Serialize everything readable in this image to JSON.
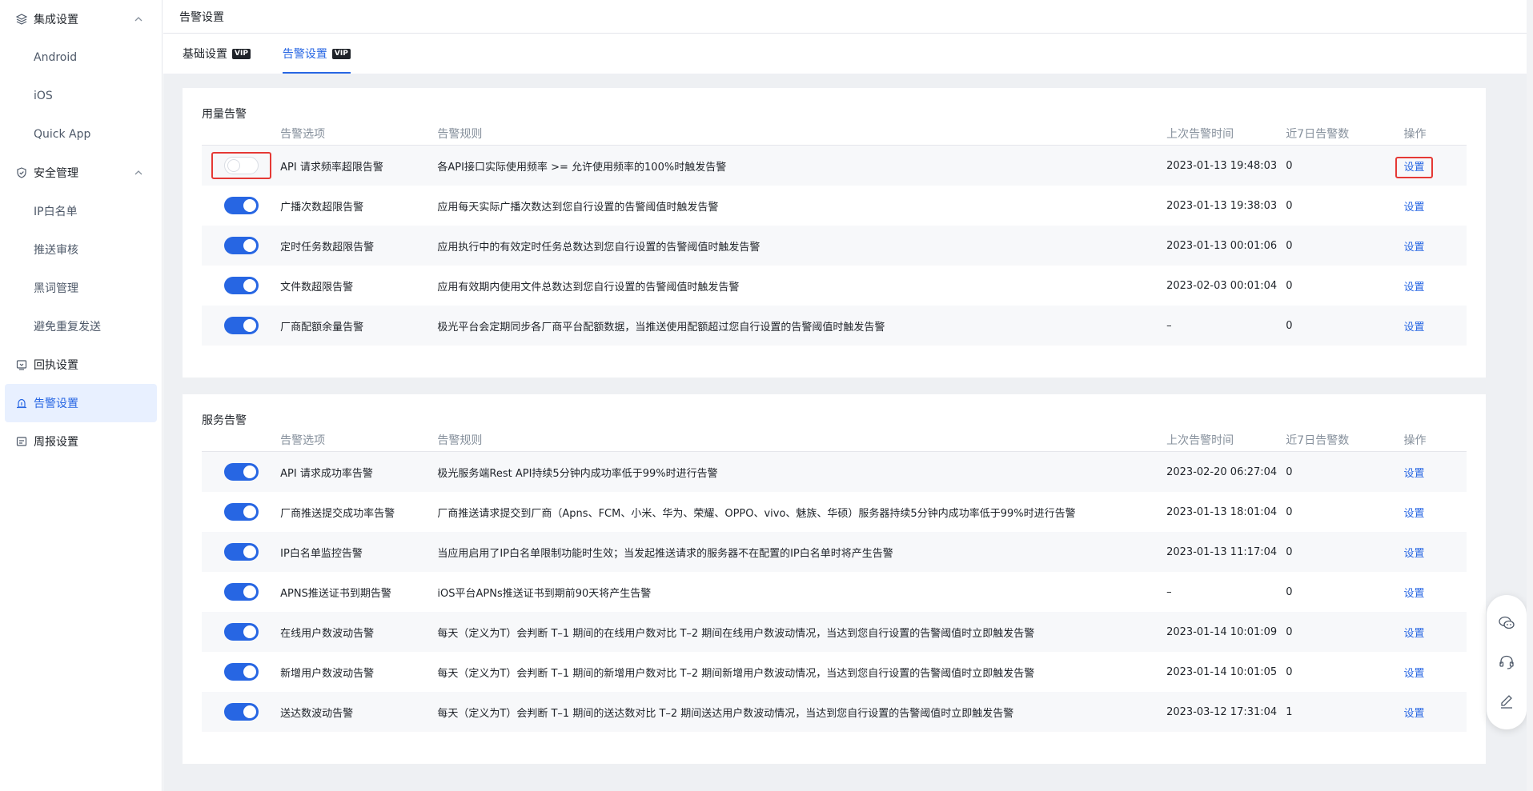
{
  "sidebar": {
    "group_integration": "集成设置",
    "integration_items": [
      "Android",
      "iOS",
      "Quick App"
    ],
    "group_security": "安全管理",
    "security_items": [
      "IP白名单",
      "推送审核",
      "黑词管理",
      "避免重复发送"
    ],
    "receipt": "回执设置",
    "alert": "告警设置",
    "weekly": "周报设置"
  },
  "topbar": {
    "title": "告警设置"
  },
  "tabs": [
    {
      "label": "基础设置",
      "badge": "VIP"
    },
    {
      "label": "告警设置",
      "badge": "VIP"
    }
  ],
  "headers": {
    "option": "告警选项",
    "rule": "告警规则",
    "last_time": "上次告警时间",
    "count7": "近7日告警数",
    "op": "操作"
  },
  "usage": {
    "title": "用量告警",
    "rows": [
      {
        "enabled": false,
        "name": "API 请求频率超限告警",
        "rule": "各API接口实际使用频率 >= 允许使用频率的100%时触发告警",
        "time": "2023-01-13 19:48:03",
        "count": "0",
        "op": "设置"
      },
      {
        "enabled": true,
        "name": "广播次数超限告警",
        "rule": "应用每天实际广播次数达到您自行设置的告警阈值时触发告警",
        "time": "2023-01-13 19:38:03",
        "count": "0",
        "op": "设置"
      },
      {
        "enabled": true,
        "name": "定时任务数超限告警",
        "rule": "应用执行中的有效定时任务总数达到您自行设置的告警阈值时触发告警",
        "time": "2023-01-13 00:01:06",
        "count": "0",
        "op": "设置"
      },
      {
        "enabled": true,
        "name": "文件数超限告警",
        "rule": "应用有效期内使用文件总数达到您自行设置的告警阈值时触发告警",
        "time": "2023-02-03 00:01:04",
        "count": "0",
        "op": "设置"
      },
      {
        "enabled": true,
        "name": "厂商配额余量告警",
        "rule": "极光平台会定期同步各厂商平台配额数据，当推送使用配额超过您自行设置的告警阈值时触发告警",
        "time": "–",
        "count": "0",
        "op": "设置"
      }
    ]
  },
  "service": {
    "title": "服务告警",
    "rows": [
      {
        "enabled": true,
        "name": "API 请求成功率告警",
        "rule": "极光服务端Rest API持续5分钟内成功率低于99%时进行告警",
        "time": "2023-02-20 06:27:04",
        "count": "0",
        "op": "设置"
      },
      {
        "enabled": true,
        "name": "厂商推送提交成功率告警",
        "rule": "厂商推送请求提交到厂商（Apns、FCM、小米、华为、荣耀、OPPO、vivo、魅族、华硕）服务器持续5分钟内成功率低于99%时进行告警",
        "time": "2023-01-13 18:01:04",
        "count": "0",
        "op": "设置"
      },
      {
        "enabled": true,
        "name": "IP白名单监控告警",
        "rule": "当应用启用了IP白名单限制功能时生效；当发起推送请求的服务器不在配置的IP白名单时将产生告警",
        "time": "2023-01-13 11:17:04",
        "count": "0",
        "op": "设置"
      },
      {
        "enabled": true,
        "name": "APNS推送证书到期告警",
        "rule": "iOS平台APNs推送证书到期前90天将产生告警",
        "time": "–",
        "count": "0",
        "op": "设置"
      },
      {
        "enabled": true,
        "name": "在线用户数波动告警",
        "rule": "每天（定义为T）会判断 T–1 期间的在线用户数对比 T–2 期间在线用户数波动情况，当达到您自行设置的告警阈值时立即触发告警",
        "time": "2023-01-14 10:01:09",
        "count": "0",
        "op": "设置"
      },
      {
        "enabled": true,
        "name": "新增用户数波动告警",
        "rule": "每天（定义为T）会判断 T–1 期间的新增用户数对比 T–2 期间新增用户数波动情况，当达到您自行设置的告警阈值时立即触发告警",
        "time": "2023-01-14 10:01:05",
        "count": "0",
        "op": "设置"
      },
      {
        "enabled": true,
        "name": "送达数波动告警",
        "rule": "每天（定义为T）会判断 T–1 期间的送达数对比 T–2 期间送达用户数波动情况，当达到您自行设置的告警阈值时立即触发告警",
        "time": "2023-03-12 17:31:04",
        "count": "1",
        "op": "设置"
      }
    ]
  },
  "floating": {
    "icons": [
      "wechat-icon",
      "headset-icon",
      "edit-icon"
    ]
  }
}
